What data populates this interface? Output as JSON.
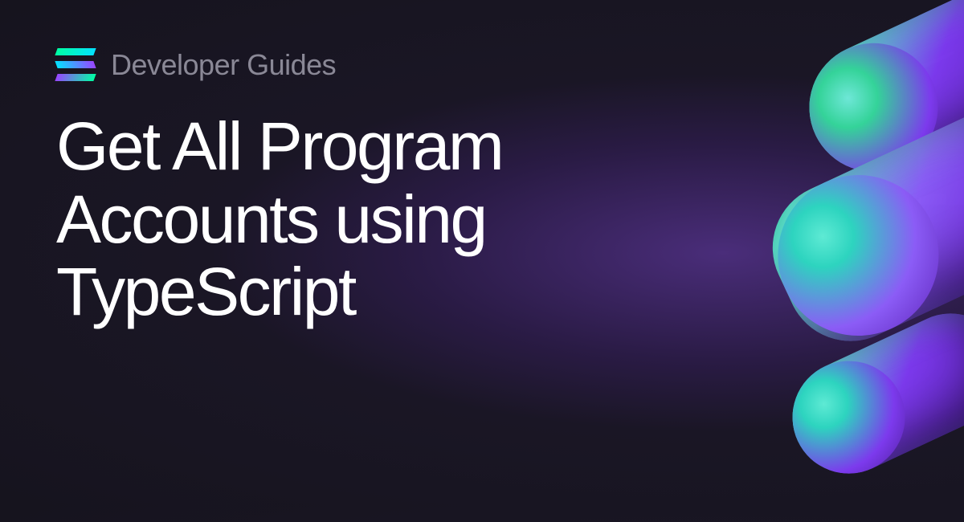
{
  "category": "Developer Guides",
  "title": "Get All Program Accounts using TypeScript",
  "brand": {
    "name": "Solana",
    "gradient_colors": [
      "#00ffa3",
      "#03e1ff",
      "#9945ff"
    ]
  },
  "accent_colors": {
    "teal": "#2dd4bf",
    "purple": "#7c3aed",
    "deep_purple": "#4c1d95"
  }
}
